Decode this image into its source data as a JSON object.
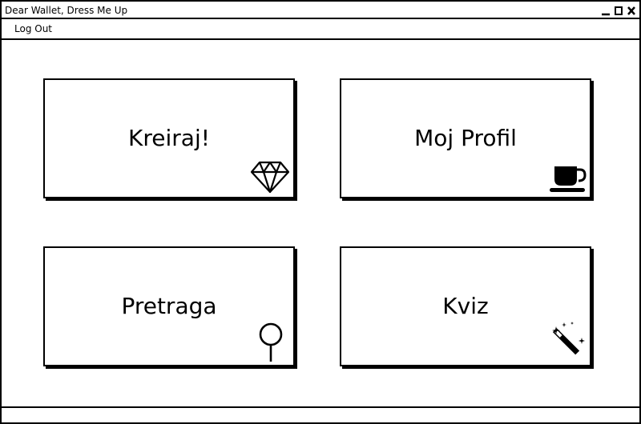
{
  "window": {
    "title": "Dear Wallet, Dress Me Up"
  },
  "menu": {
    "items": [
      {
        "label": "Log Out"
      }
    ]
  },
  "tiles": [
    {
      "label": "Kreiraj!",
      "icon": "diamond-icon"
    },
    {
      "label": "Moj Profil",
      "icon": "coffee-cup-icon"
    },
    {
      "label": "Pretraga",
      "icon": "search-icon"
    },
    {
      "label": "Kviz",
      "icon": "magic-wand-icon"
    }
  ]
}
